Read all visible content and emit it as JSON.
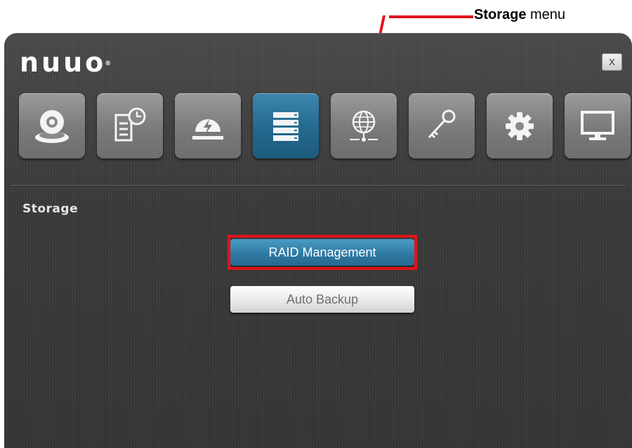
{
  "callout": {
    "bold": "Storage",
    "rest": " menu",
    "color": "#e0141a"
  },
  "window": {
    "logo": "nuuo",
    "logo_mark": "®",
    "close_label": "X"
  },
  "toolbar": {
    "items": [
      {
        "icon": "camera-icon",
        "active": false
      },
      {
        "icon": "schedule-icon",
        "active": false
      },
      {
        "icon": "event-icon",
        "active": false
      },
      {
        "icon": "storage-icon",
        "active": true
      },
      {
        "icon": "network-icon",
        "active": false
      },
      {
        "icon": "key-icon",
        "active": false
      },
      {
        "icon": "gear-icon",
        "active": false
      },
      {
        "icon": "monitor-icon",
        "active": false
      }
    ],
    "active_color": "#2a7199"
  },
  "storage": {
    "title": "Storage",
    "buttons": {
      "raid": "RAID Management",
      "backup": "Auto Backup"
    }
  }
}
